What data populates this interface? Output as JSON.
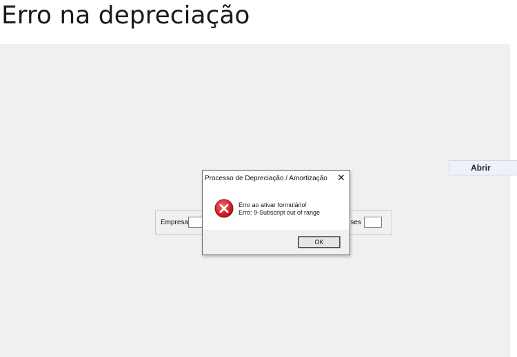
{
  "page": {
    "title": "Erro na depreciação"
  },
  "toolbar": {
    "open_label": "Abrir"
  },
  "form": {
    "empresa_label": "Empresa:",
    "meses_label": "Meses:",
    "empresa_value": "",
    "meses_value": ""
  },
  "dialog": {
    "title": "Processo de Depreciação / Amortização",
    "close_glyph": "✕",
    "message_line1": "Erro ao ativar formulário!",
    "message_line2": "Erro: 9-Subscript out of range",
    "ok_label": "OK",
    "icon": "error-icon"
  },
  "colors": {
    "error_red": "#d9262b",
    "app_background": "#f0f0f0"
  }
}
